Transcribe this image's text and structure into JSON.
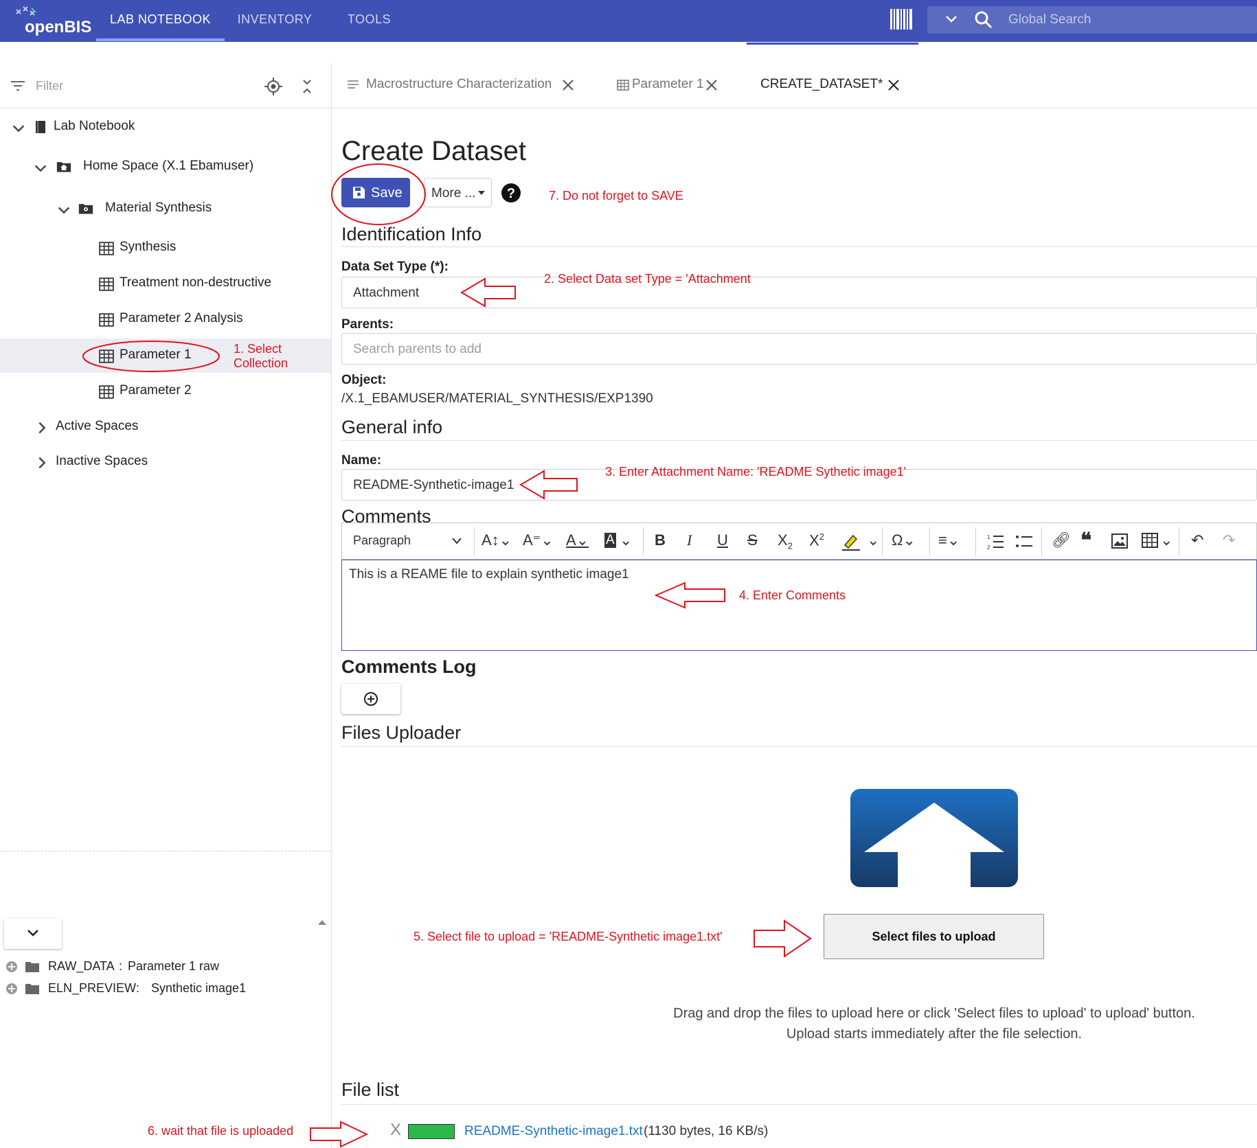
{
  "app": {
    "logo_text": "openBIS"
  },
  "nav": {
    "tabs": [
      "LAB NOTEBOOK",
      "INVENTORY",
      "TOOLS"
    ]
  },
  "search": {
    "placeholder": "Global Search"
  },
  "left": {
    "filter_placeholder": "Filter",
    "tree": {
      "lab_notebook": "Lab Notebook",
      "home_space": "Home Space (X.1 Ebamuser)",
      "material_synthesis": "Material Synthesis",
      "synthesis": "Synthesis",
      "treatment": "Treatment non-destructive",
      "param2_analysis": "Parameter 2 Analysis",
      "param1": "Parameter 1",
      "param2": "Parameter 2",
      "active_spaces": "Active Spaces",
      "inactive_spaces": "Inactive Spaces"
    },
    "datasets": [
      {
        "type": "RAW_DATA",
        "name": "Parameter 1 raw"
      },
      {
        "type": "ELN_PREVIEW",
        "name": "Synthetic image1"
      }
    ]
  },
  "tabs": [
    {
      "label": "Macrostructure Characterization"
    },
    {
      "label": "Parameter 1"
    },
    {
      "label": "CREATE_DATASET*"
    }
  ],
  "form": {
    "title": "Create Dataset",
    "save_label": "Save",
    "more_label": "More ...",
    "identification_title": "Identification Info",
    "dataset_type_label": "Data Set Type (*):",
    "dataset_type_value": "Attachment",
    "parents_label": "Parents:",
    "parents_placeholder": "Search parents to add",
    "object_label": "Object:",
    "object_value": "/X.1_EBAMUSER/MATERIAL_SYNTHESIS/EXP1390",
    "general_title": "General info",
    "name_label": "Name:",
    "name_value": "README-Synthetic-image1",
    "comments_title": "Comments",
    "paragraph_select": "Paragraph",
    "comment_text": "This is a REAME file to explain synthetic image1",
    "comments_log_title": "Comments Log",
    "files_uploader_title": "Files Uploader",
    "select_files_label": "Select files to upload",
    "drag_drop_line1": "Drag and drop the files to upload here or click 'Select files to upload' to upload' button.",
    "drag_drop_line2": "Upload starts immediately after the file selection.",
    "file_list_title": "File list",
    "file_remove": "X",
    "file_name": "README-Synthetic-image1.txt",
    "file_info": "(1130 bytes, 16 KB/s)",
    "file_progress": 1.0
  },
  "annotations": {
    "a1_line1": "1. Select",
    "a1_line2": "Collection",
    "a2": "2. Select Data set Type = 'Attachment",
    "a3": "3. Enter Attachment Name: 'README Sythetic image1'",
    "a4": "4. Enter Comments",
    "a5": "5. Select file to upload = 'README-Synthetic image1.txt'",
    "a6": "6. wait that file is uploaded",
    "a7": "7. Do not forget to SAVE"
  },
  "colors": {
    "brand": "#3f51b5",
    "annotation": "#e0141e",
    "progress": "#2db84b",
    "link": "#1a73c8"
  }
}
